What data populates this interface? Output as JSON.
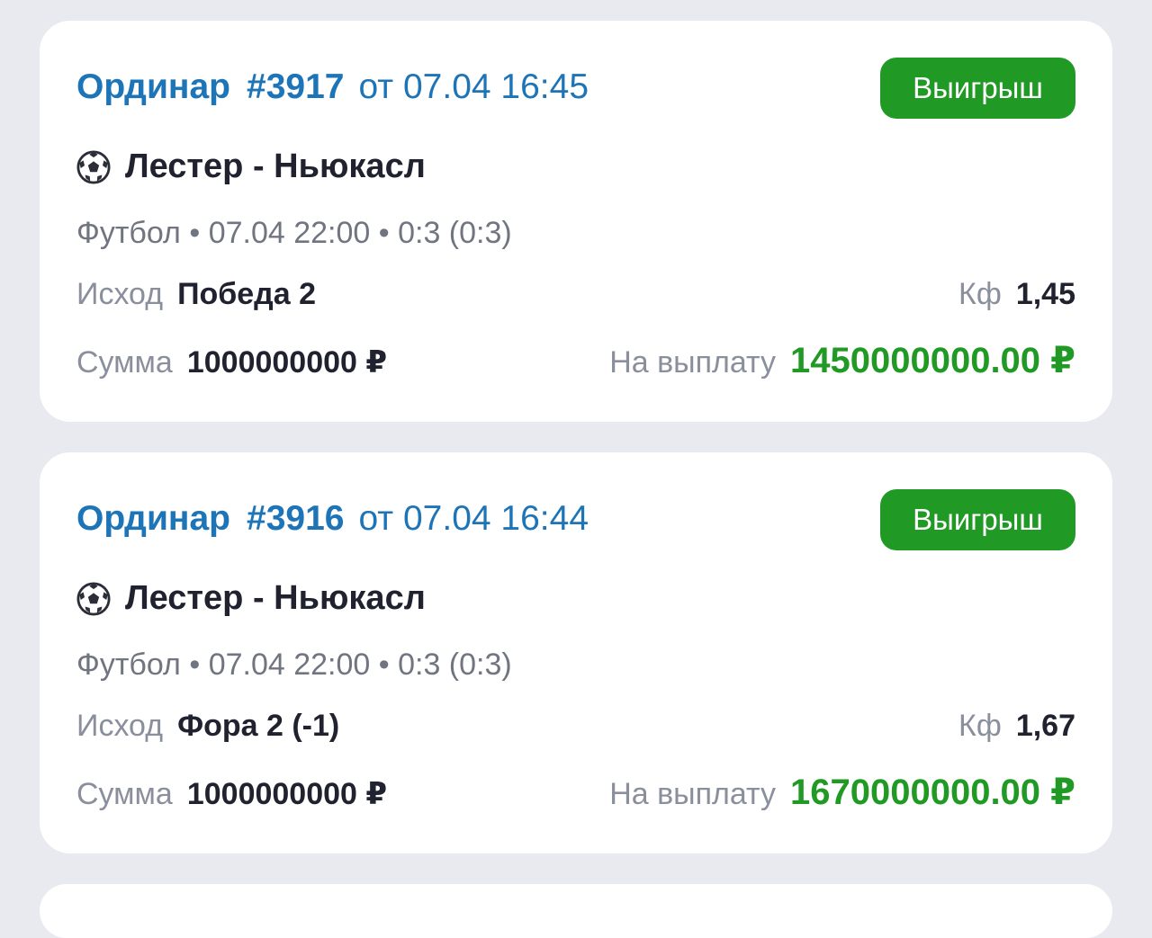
{
  "colors": {
    "accent_blue": "#1d74b6",
    "win_green": "#219a25",
    "background": "#e9eaef",
    "text_dark": "#20232f"
  },
  "bets": [
    {
      "type": "Ординар",
      "number": "#3917",
      "date": "от 07.04 16:45",
      "status": "Выигрыш",
      "sport_icon": "soccer-ball-icon",
      "match": "Лестер - Ньюкасл",
      "meta": "Футбол • 07.04 22:00 • 0:3 (0:3)",
      "outcome_label": "Исход",
      "outcome": "Победа 2",
      "coef_label": "Кф",
      "coef": "1,45",
      "sum_label": "Сумма",
      "sum": "1000000000 ₽",
      "payout_label": "На выплату",
      "payout": "1450000000.00 ₽"
    },
    {
      "type": "Ординар",
      "number": "#3916",
      "date": "от 07.04 16:44",
      "status": "Выигрыш",
      "sport_icon": "soccer-ball-icon",
      "match": "Лестер - Ньюкасл",
      "meta": "Футбол • 07.04 22:00 • 0:3 (0:3)",
      "outcome_label": "Исход",
      "outcome": "Фора 2 (-1)",
      "coef_label": "Кф",
      "coef": "1,67",
      "sum_label": "Сумма",
      "sum": "1000000000 ₽",
      "payout_label": "На выплату",
      "payout": "1670000000.00 ₽"
    }
  ]
}
